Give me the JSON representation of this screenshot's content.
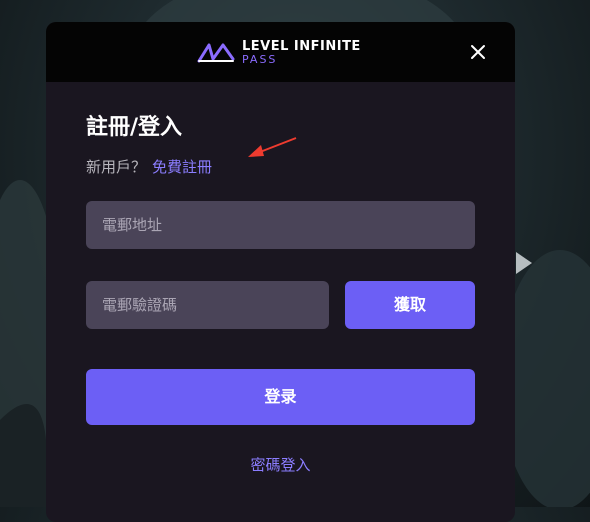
{
  "logo": {
    "line1": "LEVEL INFINITE",
    "line2": "PASS"
  },
  "modal": {
    "title": "註冊/登入",
    "new_user_prompt": "新用戶？",
    "signup_link": "免費註冊",
    "email_placeholder": "電郵地址",
    "code_placeholder": "電郵驗證碼",
    "get_code_button": "獲取",
    "login_button": "登录",
    "password_login_link": "密碼登入"
  },
  "colors": {
    "accent": "#6c5ff5",
    "link": "#8b7dff",
    "modal_bg": "#1a1620",
    "input_bg": "#4a4458",
    "header_bg": "#040404",
    "annotation_arrow": "#ee3b2f"
  },
  "icons": {
    "logo": "level-infinite-logo-icon",
    "close": "close-icon",
    "next": "next-arrow-icon",
    "annotation": "red-pointer-arrow-icon"
  }
}
